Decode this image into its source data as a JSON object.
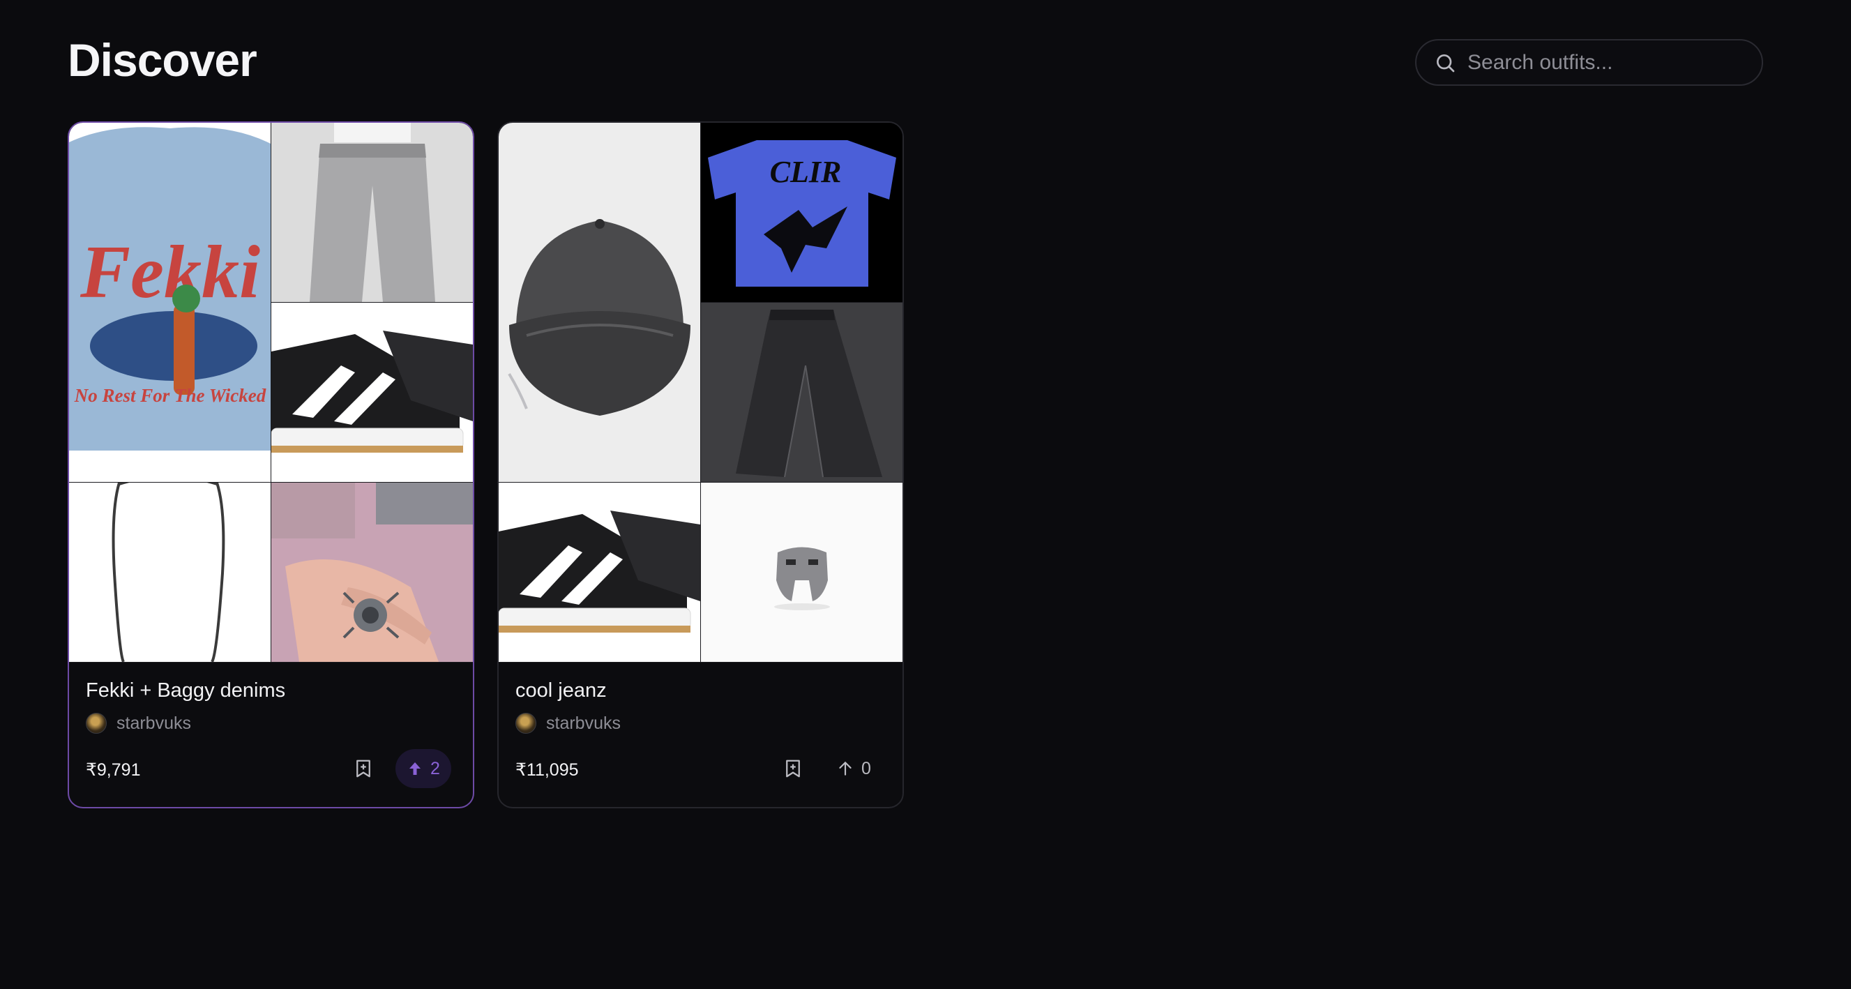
{
  "header": {
    "title": "Discover",
    "search_placeholder": "Search outfits..."
  },
  "cards": [
    {
      "name": "Fekki + Baggy denims",
      "owner": "starbvuks",
      "price": "₹9,791",
      "votes": "2",
      "voted": true,
      "items": [
        "graphic-tee",
        "baggy-jeans",
        "sneakers",
        "chain-necklace",
        "spider-ring"
      ],
      "tee_text": {
        "main": "Fekki",
        "sub": "No Rest For The Wicked"
      }
    },
    {
      "name": "cool jeanz",
      "owner": "starbvuks",
      "price": "₹11,095",
      "votes": "0",
      "voted": false,
      "items": [
        "cap",
        "blue-tee",
        "dark-jeans",
        "sneakers",
        "mask-ring"
      ],
      "tee_text": {
        "main": "CLIR"
      }
    }
  ],
  "colors": {
    "background": "#0b0b0e",
    "accent": "#6d4aa6",
    "vote_active": "#8a62d6"
  }
}
